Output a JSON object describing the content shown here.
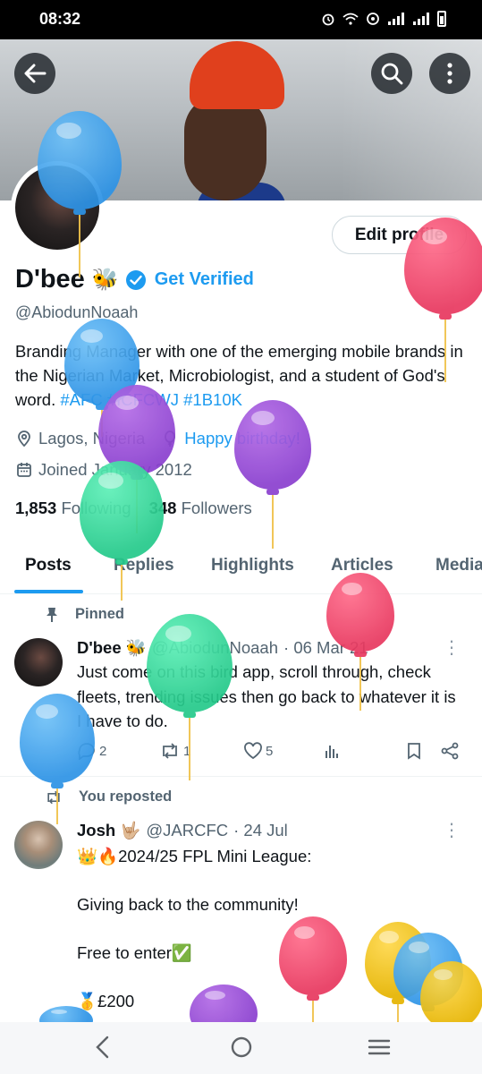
{
  "status_bar": {
    "time": "08:32"
  },
  "profile": {
    "name": "D'bee",
    "name_emoji": "🐝",
    "get_verified": "Get Verified",
    "handle": "@AbiodunNoaah",
    "edit_profile": "Edit profile",
    "bio_text": "Branding Manager with one of the emerging mobile brands in the Nigerian Market, Microbiologist, and a student of God's word.",
    "bio_tags": "#AFC #ICFCWJ #1B10K",
    "location": "Lagos, Nigeria",
    "birthday": "Happy birthday!",
    "joined": "Joined January 2012",
    "following_count": "1,853",
    "following_label": "Following",
    "followers_count": "348",
    "followers_label": "Followers"
  },
  "tabs": [
    {
      "label": "Posts"
    },
    {
      "label": "Replies"
    },
    {
      "label": "Highlights"
    },
    {
      "label": "Articles"
    },
    {
      "label": "Media"
    }
  ],
  "pinned_post": {
    "context": "Pinned",
    "author_name": "D'bee 🐝",
    "author_handle": "@AbiodunNoaah",
    "date": "· 06 Mar 21",
    "text": "Just come on this bird app, scroll through, check fleets, trending issues then go back to whatever it is I have to do.",
    "replies": "2",
    "reposts": "1",
    "likes": "5"
  },
  "repost": {
    "context": "You reposted",
    "author_name": "Josh 🤟🏼",
    "author_handle": "@JARCFC",
    "date": "· 24 Jul",
    "line1": "👑🔥2024/25 FPL Mini League:",
    "line2": "Giving back to the community!",
    "line3": "Free to enter✅",
    "line4": "🥇£200"
  },
  "colors": {
    "accent": "#1d9bf0",
    "text_primary": "#0f1419",
    "text_secondary": "#536471"
  }
}
